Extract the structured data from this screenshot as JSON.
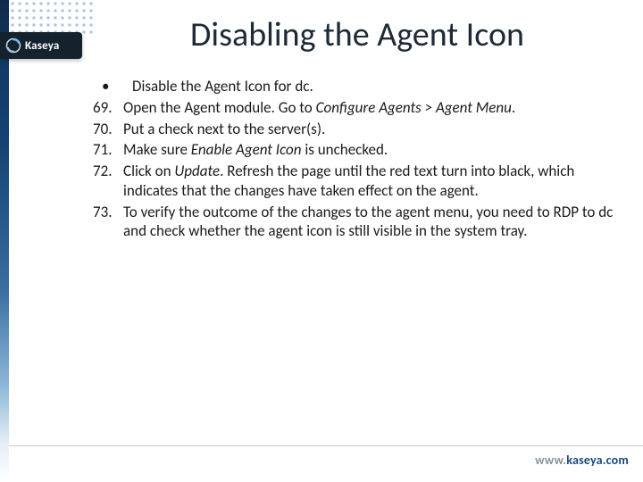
{
  "brand": {
    "name": "Kaseya",
    "url_prefix": "www.",
    "url_domain": "kaseya.com"
  },
  "title": "Disabling the Agent Icon",
  "list": {
    "intro": {
      "marker": "•",
      "text": "Disable the Agent Icon for dc."
    },
    "items": [
      {
        "marker": "69.",
        "segments": [
          {
            "t": "Open the Agent module. Go to "
          },
          {
            "t": "Configure Agents > Agent Menu",
            "style": "i"
          },
          {
            "t": "."
          }
        ]
      },
      {
        "marker": "70.",
        "segments": [
          {
            "t": "Put a check next to the server(s)."
          }
        ]
      },
      {
        "marker": "71.",
        "segments": [
          {
            "t": "Make sure "
          },
          {
            "t": "Enable Agent Icon",
            "style": "i"
          },
          {
            "t": " is unchecked."
          }
        ]
      },
      {
        "marker": "72.",
        "segments": [
          {
            "t": "Click on "
          },
          {
            "t": "Update",
            "style": "i"
          },
          {
            "t": ". Refresh the page until the red text turn into black, which indicates that the changes have taken effect on the agent."
          }
        ]
      },
      {
        "marker": "73.",
        "segments": [
          {
            "t": "To verify the outcome of the changes to the agent menu, you need to RDP to dc and check whether the agent icon is still visible in the system tray."
          }
        ]
      }
    ]
  }
}
